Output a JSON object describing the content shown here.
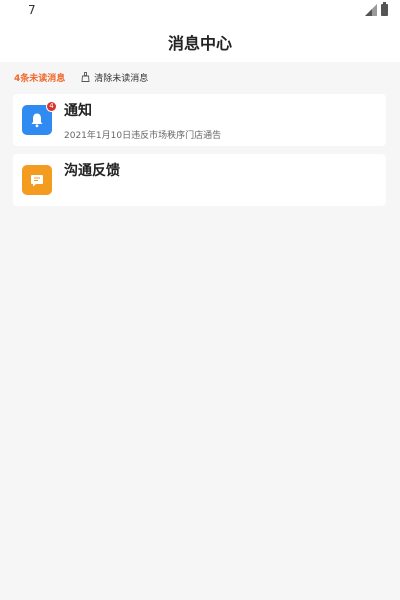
{
  "status_bar": {
    "time": "7",
    "icons": [
      "signal-icon",
      "battery-icon"
    ]
  },
  "header": {
    "title": "消息中心"
  },
  "unread": {
    "count_text": "4条未读消息",
    "clear_label": "清除未读消息",
    "clear_icon": "broom-icon",
    "accent_color": "#ef6a2c"
  },
  "items": [
    {
      "title": "通知",
      "description": "2021年1月10日违反市场秩序门店通告",
      "icon": "bell-icon",
      "icon_color": "#2f8af1",
      "badge": "4"
    },
    {
      "title": "沟通反馈",
      "icon": "chat-icon",
      "icon_color": "#f39c1f"
    }
  ]
}
